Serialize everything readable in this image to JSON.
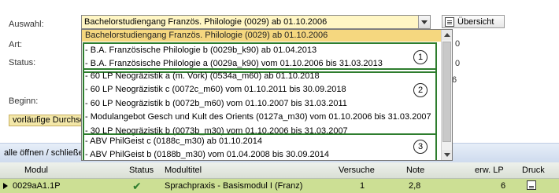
{
  "form": {
    "auswahl_label": "Auswahl:",
    "art_label": "Art:",
    "status_label": "Status:",
    "beginn_label": "Beginn:",
    "selected_value": "Bachelorstudiengang Französ. Philologie (0029) ab 01.10.2006",
    "uebersicht_label": "Übersicht",
    "vorlaeufig_label": "vorläufige Durchschnitt"
  },
  "dropdown": {
    "selected_option": "Bachelorstudiengang Französ. Philologie (0029) ab 01.10.2006",
    "groups": [
      {
        "marker": "1",
        "options": [
          "- B.A. Französische Philologie b (0029b_k90) ab 01.04.2013",
          "- B.A. Französische Philologie a (0029a_k90) vom 01.10.2006 bis 31.03.2013"
        ]
      },
      {
        "marker": "2",
        "options": [
          "- 60 LP Neogräzistik a (m. Vork) (0534a_m60) ab 01.10.2018",
          "- 60 LP Neogräzistik c (0072c_m60) vom 01.10.2011 bis 30.09.2018",
          "- 60 LP Neogräzistik b (0072b_m60) vom 01.10.2007 bis 31.03.2011",
          "- Modulangebot Gesch und Kult des Orients (0127a_m30) vom 01.10.2006 bis 31.03.2007",
          "- 30 LP Neogräzistik b (0073b_m30) vom 01.10.2006 bis 31.03.2007"
        ]
      },
      {
        "marker": "3",
        "options": [
          "- ABV PhilGeist c (0188c_m30) ab 01.10.2014",
          "- ABV PhilGeist b (0188b_m30) vom 01.04.2008 bis 30.09.2014"
        ]
      }
    ],
    "hidden_fragments": [
      "0",
      "0",
      "6"
    ]
  },
  "toolbar": {
    "expand_text": "alle öffnen / schließen"
  },
  "table": {
    "headers": [
      "Modul",
      "Status",
      "Modultitel",
      "Versuche",
      "Note",
      "erw. LP",
      "Druck"
    ],
    "rows": [
      {
        "modul": "0029aA1.1P",
        "status_icon": "check-icon",
        "titel": "Sprachpraxis - Basismodul I (Franz)",
        "versuche": "1",
        "note": "2,8",
        "lp": "6"
      }
    ]
  },
  "colors": {
    "highlight": "#f5d77f",
    "group_border": "#2e7d2e",
    "row_green": "#ccdf94"
  }
}
